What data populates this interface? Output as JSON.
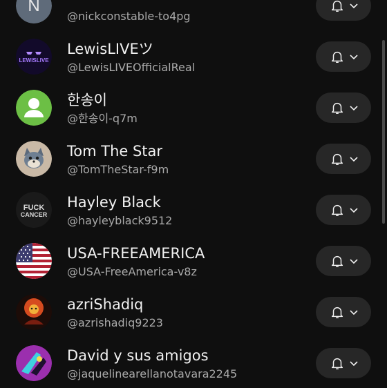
{
  "channels": [
    {
      "name": "",
      "handle": "@nickconstable-to4pg",
      "avatar": "letter-avatar",
      "avatar_letter": "N",
      "avatar_color": "#5f6b7a"
    },
    {
      "name": "LewisLIVEツ",
      "handle": "@LewisLIVEOfficialReal",
      "avatar": "neon-logo-avatar",
      "avatar_text": "LEWISLIVE",
      "avatar_color": "#7a3cff"
    },
    {
      "name": "한송이",
      "handle": "@한송이-q7m",
      "avatar": "default-person-avatar",
      "avatar_color": "#6cbf45"
    },
    {
      "name": "Tom The Star",
      "handle": "@TomTheStar-f9m",
      "avatar": "cartoon-cat-avatar",
      "avatar_color": "#c9b9a6"
    },
    {
      "name": "Hayley Black",
      "handle": "@hayleyblack9512",
      "avatar": "text-logo-avatar",
      "avatar_text_line1": "FUCK",
      "avatar_text_line2": "CANCER",
      "avatar_color": "#1a1a1a"
    },
    {
      "name": "USA-FREEAMERICA",
      "handle": "@USA-FreeAmerica-v8z",
      "avatar": "us-flag-avatar",
      "avatar_color": "#b22234"
    },
    {
      "name": "azriShadiq",
      "handle": "@azrishadiq9223",
      "avatar": "character-avatar",
      "avatar_color": "#d64b1f"
    },
    {
      "name": "David y sus amigos",
      "handle": "@jaquelinearellanotavara2245",
      "avatar": "purple-art-avatar",
      "avatar_color": "#9b2fae"
    }
  ],
  "notification_button": {
    "icon": "bell-icon",
    "chevron": "chevron-down-icon"
  },
  "colors": {
    "background": "#0f0f0f",
    "button": "#272727",
    "text": "#f1f1f1",
    "subtext": "#aaaaaa"
  }
}
